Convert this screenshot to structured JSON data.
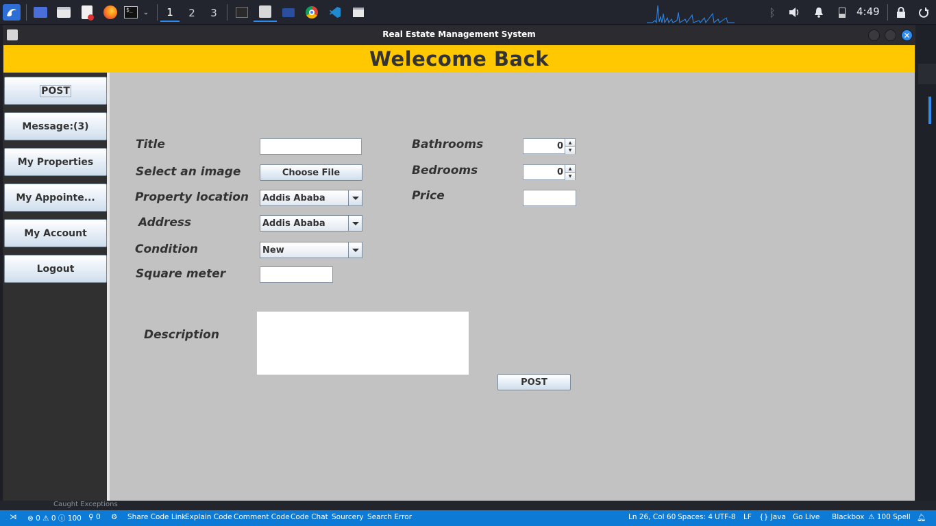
{
  "taskbar": {
    "workspaces": [
      "1",
      "2",
      "3"
    ],
    "clock": "4:49",
    "icons": [
      "kali-menu-icon",
      "show-desktop-icon",
      "file-manager-icon",
      "text-editor-icon",
      "firefox-icon",
      "terminal-icon",
      "dropdown-chevron-icon",
      "terminal-window-icon",
      "java-app-icon",
      "folder-icon",
      "chrome-icon",
      "vscode-icon",
      "window-icon",
      "cpu-graph-icon",
      "bluetooth-icon",
      "volume-icon",
      "notification-bell-icon",
      "battery-icon",
      "lock-icon",
      "power-icon"
    ]
  },
  "window": {
    "title": "Real Estate Management System"
  },
  "banner": {
    "text": "Welecome Back",
    "color": "#ffc800"
  },
  "sidebar": {
    "items": [
      {
        "label": "POST"
      },
      {
        "label": "Message:(3)"
      },
      {
        "label": "My Properties"
      },
      {
        "label": "My Appointe..."
      },
      {
        "label": "My Account"
      },
      {
        "label": "Logout"
      }
    ]
  },
  "form": {
    "title_label": "Title",
    "title_value": "",
    "image_label": "Select an image",
    "choose_file": "Choose File",
    "location_label": "Property location",
    "location_value": "Addis Ababa",
    "address_label": "Address",
    "address_value": "Addis Ababa",
    "condition_label": "Condition",
    "condition_value": "New",
    "square_label": "Square meter",
    "square_value": "",
    "bathrooms_label": "Bathrooms",
    "bathrooms_value": "0",
    "bedrooms_label": "Bedrooms",
    "bedrooms_value": "0",
    "price_label": "Price",
    "price_value": "",
    "description_label": "Description",
    "description_value": "",
    "post_button": "POST"
  },
  "ide": {
    "partial_text": "Caught Exceptions"
  },
  "statusbar": {
    "problems": "⊗ 0 ⚠ 0 ⓘ 100",
    "ports": "⚲ 0",
    "items": [
      "Share Code Link",
      "Explain Code",
      "Comment Code",
      "Code Chat",
      "Sourcery",
      "Search Error"
    ],
    "position": "Ln 26, Col 60",
    "spaces": "Spaces: 4",
    "encoding": "UTF-8",
    "eol": "LF",
    "language": "{} Java",
    "golive": "Go Live",
    "blackbox": "Blackbox",
    "spell": "⚠ 100 Spell",
    "accent": "#0d7ad6"
  }
}
